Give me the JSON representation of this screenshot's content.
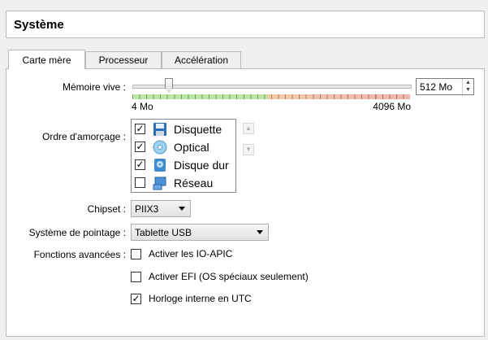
{
  "header": {
    "title": "Système"
  },
  "tabs": [
    {
      "label": "Carte mère",
      "active": true
    },
    {
      "label": "Processeur",
      "active": false
    },
    {
      "label": "Accélération",
      "active": false
    }
  ],
  "memory": {
    "label": "Mémoire vive :",
    "min_label": "4 Mo",
    "max_label": "4096 Mo",
    "value": "512 Mo",
    "value_mb": 512,
    "range_mb": [
      4,
      4096
    ]
  },
  "boot": {
    "label": "Ordre d'amorçage :",
    "items": [
      {
        "label": "Disquette",
        "checked": true,
        "icon": "floppy-icon"
      },
      {
        "label": "Optical",
        "checked": true,
        "icon": "optical-disc-icon"
      },
      {
        "label": "Disque dur",
        "checked": true,
        "icon": "hard-disk-icon"
      },
      {
        "label": "Réseau",
        "checked": false,
        "icon": "network-icon"
      }
    ]
  },
  "chipset": {
    "label": "Chipset :",
    "value": "PIIX3"
  },
  "pointing": {
    "label": "Système de pointage :",
    "value": "Tablette USB"
  },
  "advanced": {
    "label": "Fonctions avancées :",
    "options": [
      {
        "label": "Activer les IO-APIC",
        "checked": false
      },
      {
        "label": "Activer EFI (OS spéciaux seulement)",
        "checked": false
      },
      {
        "label": "Horloge interne en UTC",
        "checked": true
      }
    ]
  },
  "colors": {
    "scale_green": "#b9e8a7",
    "scale_orange": "#f5d29b",
    "scale_red": "#f3b4aa"
  }
}
